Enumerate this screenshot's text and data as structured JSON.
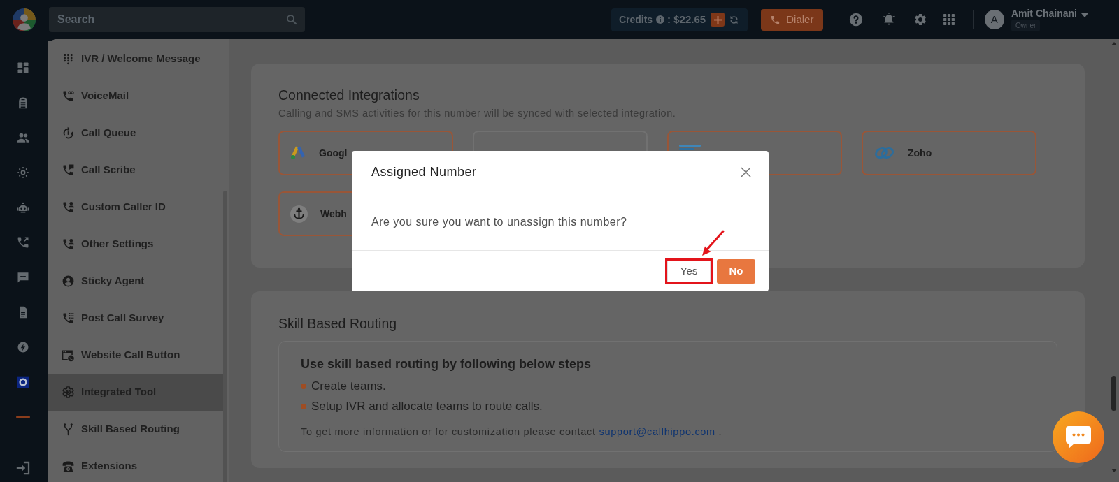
{
  "topbar": {
    "search": {
      "placeholder": "Search"
    },
    "credits": {
      "label": "Credits",
      "amount": ": $22.65"
    },
    "dialer": {
      "label": "Dialer"
    },
    "user": {
      "initial": "A",
      "name": "Amit Chainani",
      "role": "Owner"
    }
  },
  "menu": {
    "items": [
      {
        "label": "IVR / Welcome Message",
        "kind": "dialpad",
        "selected": false
      },
      {
        "label": "VoiceMail",
        "kind": "voicemail",
        "selected": false
      },
      {
        "label": "Call Queue",
        "kind": "queue",
        "selected": false
      },
      {
        "label": "Call Scribe",
        "kind": "scribe",
        "selected": false
      },
      {
        "label": "Custom Caller ID",
        "kind": "callerid",
        "selected": false
      },
      {
        "label": "Other Settings",
        "kind": "callerid",
        "selected": false
      },
      {
        "label": "Sticky Agent",
        "kind": "agent",
        "selected": false
      },
      {
        "label": "Post Call Survey",
        "kind": "survey",
        "selected": false
      },
      {
        "label": "Website Call Button",
        "kind": "webcall",
        "selected": false
      },
      {
        "label": "Integrated Tool",
        "kind": "integration",
        "selected": true
      },
      {
        "label": "Skill Based Routing",
        "kind": "routing",
        "selected": false
      },
      {
        "label": "Extensions",
        "kind": "extension",
        "selected": false
      }
    ]
  },
  "integrations": {
    "title": "Connected Integrations",
    "subtitle": "Calling and SMS activities for this number will be synced with selected integration.",
    "tiles": [
      {
        "label": "Googl",
        "kind": "ads",
        "selected": true
      },
      {
        "selected": false
      },
      {
        "kind": "bitrix",
        "selected": true
      },
      {
        "label": "Zoho",
        "kind": "zoho",
        "selected": true
      },
      {
        "label": "Webh",
        "kind": "webhook",
        "selected": true
      }
    ]
  },
  "routing": {
    "title": "Skill Based Routing",
    "heading": "Use skill based routing by following below steps",
    "steps": [
      "Create teams.",
      "Setup IVR and allocate teams to route calls."
    ],
    "contact": {
      "text": "To get more information or for customization please contact",
      "link": "support@callhippo.com",
      "end": "."
    }
  },
  "dialog": {
    "title": "Assigned Number",
    "message": "Are you sure you want to unassign this number?",
    "buttons": [
      {
        "label": "Yes",
        "kind": "secondary",
        "highlighted": true
      },
      {
        "label": "No",
        "kind": "primary",
        "highlighted": false
      }
    ]
  }
}
